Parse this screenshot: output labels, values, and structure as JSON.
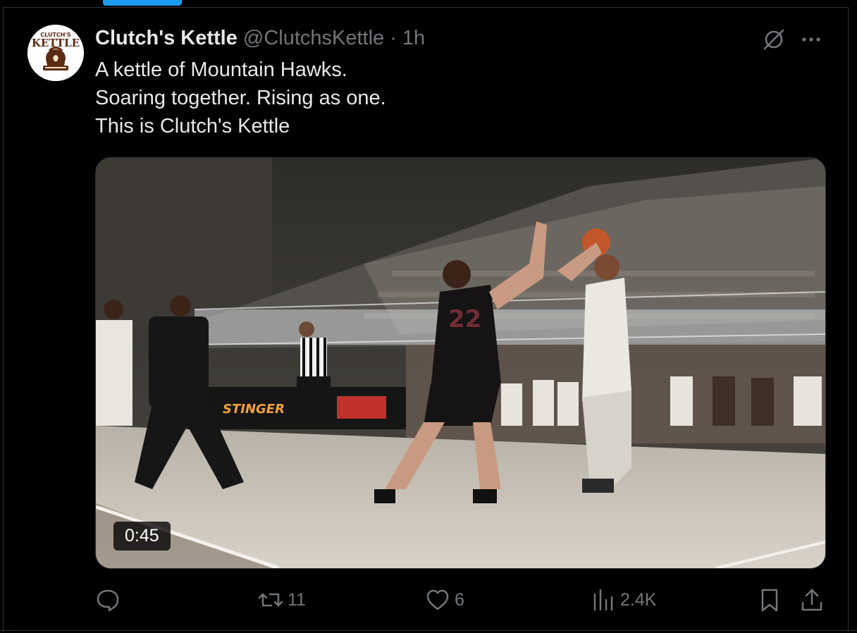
{
  "colors": {
    "background": "#000000",
    "primary_text": "#e7e9ea",
    "secondary_text": "#71767b",
    "accent": "#1d9bf0",
    "border": "#2f3336"
  },
  "tweet": {
    "avatar_logo_text_1": "CLUTCH'S",
    "avatar_logo_text_2": "KETTLE",
    "display_name": "Clutch's Kettle",
    "handle": "@ClutchsKettle",
    "separator": "·",
    "time": "1h",
    "text_lines": [
      "A kettle of Mountain Hawks.",
      "Soaring together. Rising as one.",
      "This is Clutch's Kettle"
    ],
    "media": {
      "type": "video",
      "duration": "0:45",
      "jersey_number": "22"
    },
    "actions": {
      "reply_icon": "reply-icon",
      "repost_icon": "repost-icon",
      "repost_count": "11",
      "like_icon": "heart-icon",
      "like_count": "6",
      "views_icon": "views-icon",
      "views_count": "2.4K",
      "bookmark_icon": "bookmark-icon",
      "share_icon": "share-icon"
    },
    "header_icons": {
      "grok": "grok-icon",
      "more": "more-icon"
    }
  }
}
